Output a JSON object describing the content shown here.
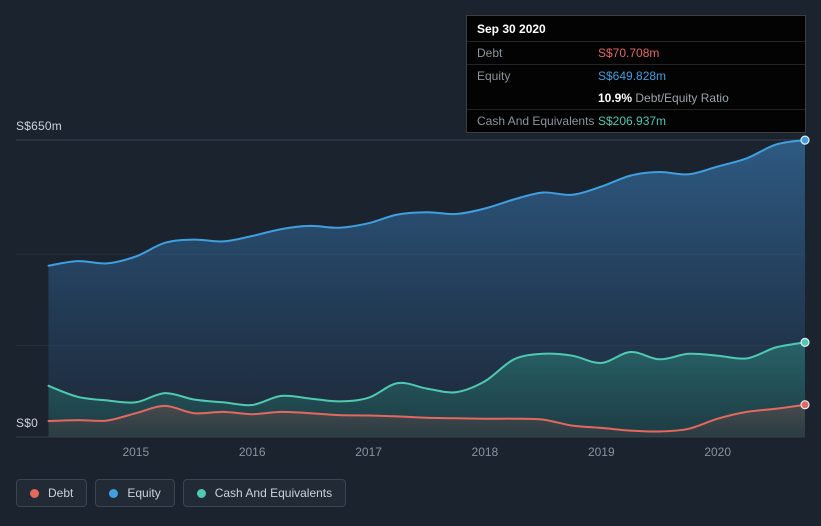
{
  "colors": {
    "debt": "#e4685f",
    "equity": "#3f9fe0",
    "cash": "#4fcab2"
  },
  "tooltip": {
    "date": "Sep 30 2020",
    "debt_label": "Debt",
    "debt_value": "S$70.708m",
    "equity_label": "Equity",
    "equity_value": "S$649.828m",
    "ratio_value": "10.9%",
    "ratio_label": "Debt/Equity Ratio",
    "cash_label": "Cash And Equivalents",
    "cash_value": "S$206.937m"
  },
  "legend": {
    "debt": "Debt",
    "equity": "Equity",
    "cash": "Cash And Equivalents"
  },
  "chart_data": {
    "type": "area",
    "y_tick_labels": {
      "top": "S$650m",
      "zero": "S$0"
    },
    "x_tick_years": [
      2015,
      2016,
      2017,
      2018,
      2019,
      2020
    ],
    "gridline_values": [
      650,
      400,
      200,
      0
    ],
    "xlim": [
      2014.25,
      2020.75
    ],
    "ylim": [
      0,
      650
    ],
    "x": [
      2014.25,
      2014.5,
      2014.75,
      2015,
      2015.25,
      2015.5,
      2015.75,
      2016,
      2016.25,
      2016.5,
      2016.75,
      2017,
      2017.25,
      2017.5,
      2017.75,
      2018,
      2018.25,
      2018.5,
      2018.75,
      2019,
      2019.25,
      2019.5,
      2019.75,
      2020,
      2020.25,
      2020.5,
      2020.75
    ],
    "series": [
      {
        "key": "equity",
        "name": "Equity",
        "values": [
          375,
          385,
          380,
          395,
          425,
          432,
          428,
          440,
          455,
          462,
          458,
          468,
          487,
          492,
          488,
          500,
          520,
          535,
          530,
          548,
          572,
          580,
          575,
          592,
          610,
          640,
          649.828
        ]
      },
      {
        "key": "cash",
        "name": "Cash And Equivalents",
        "values": [
          112,
          88,
          80,
          76,
          96,
          82,
          76,
          70,
          90,
          84,
          78,
          86,
          118,
          106,
          98,
          122,
          170,
          182,
          178,
          162,
          186,
          170,
          182,
          178,
          172,
          196,
          206.937
        ]
      },
      {
        "key": "debt",
        "name": "Debt",
        "values": [
          35,
          37,
          36,
          52,
          68,
          52,
          55,
          50,
          55,
          52,
          48,
          47,
          45,
          42,
          41,
          40,
          40,
          38,
          25,
          20,
          14,
          12,
          18,
          40,
          55,
          62,
          70.708
        ]
      }
    ]
  }
}
